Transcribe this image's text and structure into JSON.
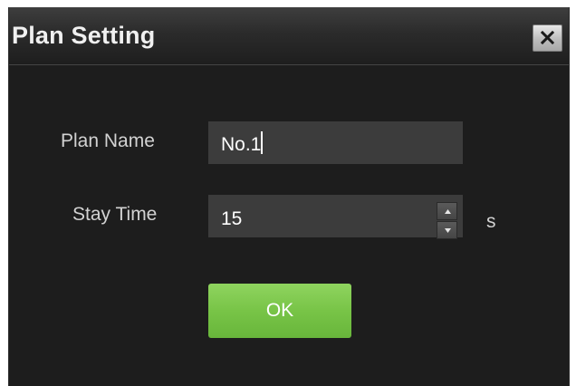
{
  "dialog": {
    "title": "Plan Setting",
    "close_icon": "close-x-icon"
  },
  "form": {
    "plan_name_label": "Plan Name",
    "plan_name_value": "No.1",
    "stay_time_label": "Stay Time",
    "stay_time_value": "15",
    "stay_time_unit": "s",
    "spinner_up_icon": "triangle-up-icon",
    "spinner_down_icon": "triangle-down-icon"
  },
  "actions": {
    "ok_label": "OK"
  },
  "colors": {
    "dialog_background": "#1d1d1d",
    "field_background": "#3c3c3c",
    "ok_button": "#78c447"
  }
}
